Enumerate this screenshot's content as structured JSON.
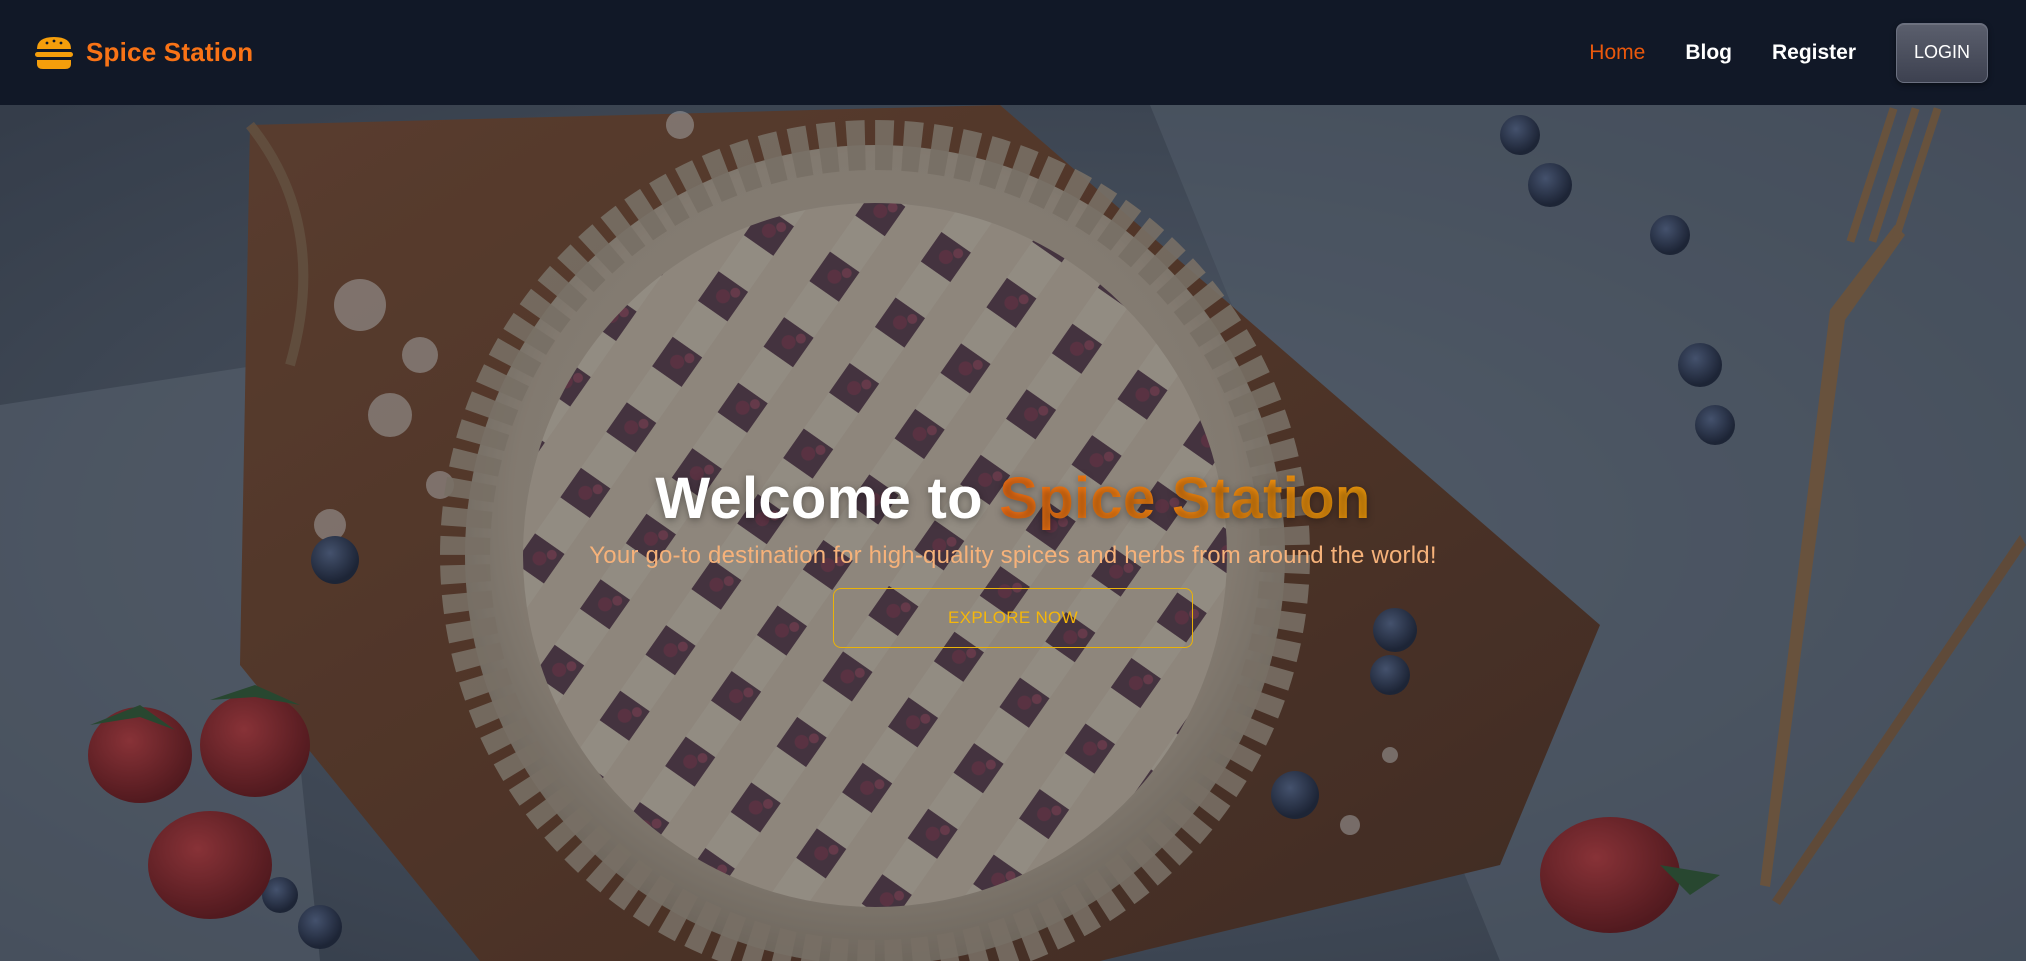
{
  "brand": {
    "name": "Spice Station",
    "icon": "burger-icon",
    "color": "#f97316"
  },
  "nav": {
    "links": [
      {
        "label": "Home",
        "active": true
      },
      {
        "label": "Blog",
        "active": false
      },
      {
        "label": "Register",
        "active": false
      }
    ],
    "login_label": "LOGIN"
  },
  "hero": {
    "title_prefix": "Welcome to ",
    "title_accent": "Spice Station",
    "subtitle": "Your go-to destination for high-quality spices and herbs from around the world!",
    "cta_label": "EXPLORE NOW",
    "background_image": "pie-with-lattice-crust-on-wooden-board",
    "accent_color": "#f59e0b"
  }
}
